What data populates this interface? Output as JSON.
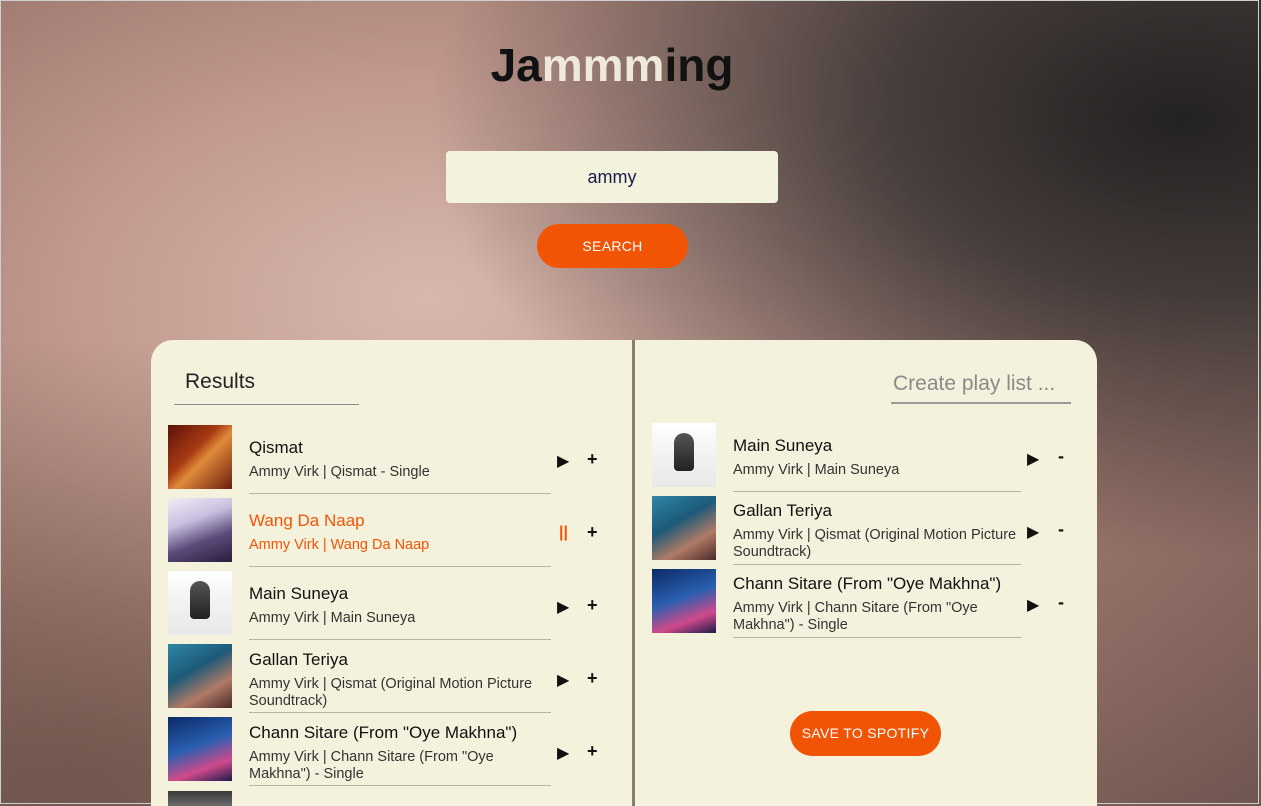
{
  "app": {
    "logo_parts": [
      "Ja",
      "mmm",
      "ing"
    ]
  },
  "search": {
    "value": "ammy",
    "button_label": "SEARCH"
  },
  "results": {
    "title": "Results",
    "tracks": [
      {
        "name": "Qismat",
        "info": "Ammy Virk | Qismat - Single",
        "play_icon": "play-icon",
        "action": "+",
        "active": false
      },
      {
        "name": "Wang Da Naap",
        "info": "Ammy Virk | Wang Da Naap",
        "play_icon": "pause-icon",
        "action": "+",
        "active": true
      },
      {
        "name": "Main Suneya",
        "info": "Ammy Virk | Main Suneya",
        "play_icon": "play-icon",
        "action": "+",
        "active": false
      },
      {
        "name": "Gallan Teriya",
        "info": "Ammy Virk | Qismat (Original Motion Picture Soundtrack)",
        "play_icon": "play-icon",
        "action": "+",
        "active": false
      },
      {
        "name": "Chann Sitare (From \"Oye Makhna\")",
        "info": "Ammy Virk | Chann Sitare (From \"Oye Makhna\") - Single",
        "play_icon": "play-icon",
        "action": "+",
        "active": false
      }
    ],
    "play_glyph": "▶",
    "pause_glyph": "||"
  },
  "playlist": {
    "name_placeholder": "Create play list ...",
    "save_label": "SAVE TO SPOTIFY",
    "tracks": [
      {
        "name": "Main Suneya",
        "info": "Ammy Virk | Main Suneya",
        "action": "-"
      },
      {
        "name": "Gallan Teriya",
        "info": "Ammy Virk | Qismat (Original Motion Picture Soundtrack)",
        "action": "-"
      },
      {
        "name": "Chann Sitare (From \"Oye Makhna\")",
        "info": "Ammy Virk | Chann Sitare (From \"Oye Makhna\") - Single",
        "action": "-"
      }
    ]
  },
  "colors": {
    "accent": "#f25405",
    "panel_bg": "#f4f2dc",
    "input_bg": "#f3f2dc",
    "logo_highlight": "#efe9d9"
  }
}
